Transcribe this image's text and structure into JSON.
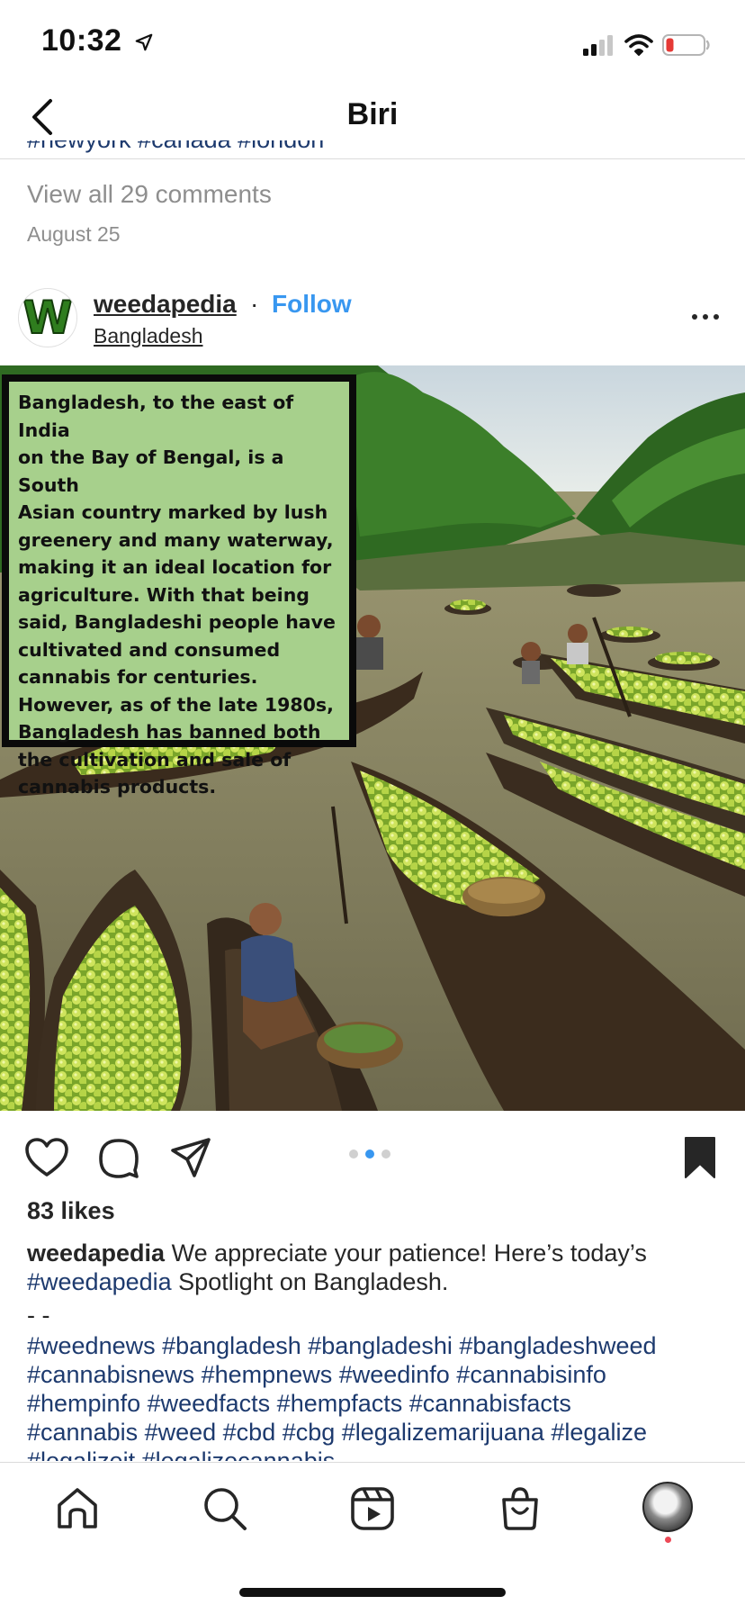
{
  "status_bar": {
    "time": "10:32"
  },
  "nav": {
    "title": "Biri"
  },
  "previous_post": {
    "caption_fragment": "#newyork #canada #london",
    "view_comments": "View all 29 comments",
    "date": "August 25"
  },
  "post": {
    "avatar_letter": "W",
    "username": "weedapedia",
    "separator": "·",
    "follow_label": "Follow",
    "location": "Bangladesh",
    "image_overlay_lines": [
      "Bangladesh, to the east of India",
      "on the Bay of Bengal, is a South",
      "Asian country marked by lush",
      "greenery and many waterway,",
      "making it an ideal location for",
      "agriculture. With that being",
      "said, Bangladeshi people have",
      "cultivated and consumed",
      "cannabis for centuries.",
      "However, as of the late 1980s,",
      "Bangladesh has banned both",
      "the cultivation and sale of",
      "cannabis products."
    ],
    "carousel": {
      "count": 3,
      "active_index": 1
    },
    "likes": "83 likes",
    "caption": {
      "username": "weedapedia",
      "text_1": "We appreciate your patience! Here’s today’s",
      "tag": "#weedapedia",
      "text_2": "Spotlight on Bangladesh.",
      "separator": "- -"
    },
    "hashtag_lines": [
      "#weednews #bangladesh #bangladeshi #bangladeshweed",
      "#cannabisnews #hempnews #weedinfo #cannabisinfo",
      "#hempinfo #weedfacts #hempfacts #cannabisfacts",
      "#cannabis #weed #cbd #cbg #legalizemarijuana #legalize",
      "#legalizeit #legalizecannabis"
    ]
  },
  "icons": {
    "back": "chevron-left-icon",
    "like": "heart-icon",
    "comment": "comment-icon",
    "share": "send-icon",
    "save": "bookmark-icon",
    "home": "home-icon",
    "search": "search-icon",
    "reels": "reels-icon",
    "shop": "shop-icon"
  },
  "colors": {
    "link": "#3897f0",
    "hashtag": "#1d3a6e",
    "secondary_text": "#8e8e8e",
    "notification": "#ed4956",
    "battery_low": "#e53935"
  }
}
